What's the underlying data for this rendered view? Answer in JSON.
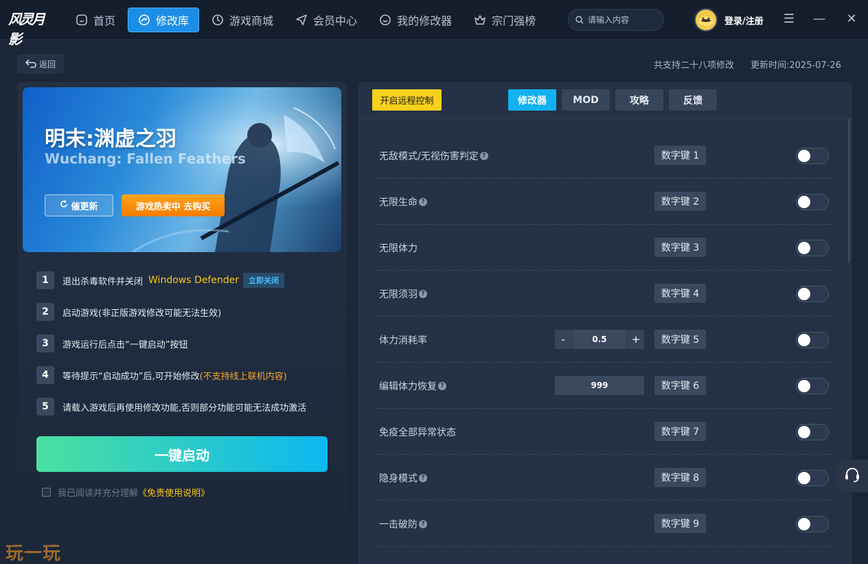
{
  "app": {
    "logo_text": "风灵月影"
  },
  "nav": {
    "items": [
      {
        "label": "首页",
        "icon": "home-icon"
      },
      {
        "label": "修改库",
        "icon": "library-icon",
        "active": true
      },
      {
        "label": "游戏商城",
        "icon": "store-icon"
      },
      {
        "label": "会员中心",
        "icon": "send-icon"
      },
      {
        "label": "我的修改器",
        "icon": "chat-icon"
      },
      {
        "label": "宗门强榜",
        "icon": "crown-icon"
      }
    ]
  },
  "search": {
    "placeholder": "请输入内容"
  },
  "user": {
    "login_label": "登录/注册"
  },
  "window": {
    "menu": "☰",
    "minimize": "—",
    "close": "✕"
  },
  "subbar": {
    "back_label": "返回",
    "support_text": "共支持二十八项修改",
    "updated_label": "更新时间:",
    "updated_date": "2025-07-26"
  },
  "game": {
    "title_cn": "明末:渊虚之羽",
    "title_en": "Wuchang: Fallen Feathers",
    "update_button": "催更新",
    "buy_button": "游戏热卖中 去购买"
  },
  "steps": [
    {
      "num": "1",
      "text": "退出杀毒软件并关闭",
      "highlight": "Windows Defender",
      "action": "立即关闭"
    },
    {
      "num": "2",
      "text": "启动游戏(非正版游戏修改可能无法生效)"
    },
    {
      "num": "3",
      "text": "游戏运行后点击“一键启动”按钮"
    },
    {
      "num": "4",
      "text": "等待提示“启动成功”后,可开始修改",
      "highlight": "(不支持线上联机内容)"
    },
    {
      "num": "5",
      "text": "请载入游戏后再使用修改功能,否则部分功能可能无法成功激活"
    }
  ],
  "launch_button": "一键启动",
  "agreement": {
    "text": "我已阅读并充分理解",
    "link": "《免责使用说明》",
    "checked": false
  },
  "watermark": "玩一玩",
  "right": {
    "remote_button": "开启远程控制",
    "tabs": [
      {
        "label": "修改器",
        "active": true
      },
      {
        "label": "MOD"
      },
      {
        "label": "攻略"
      },
      {
        "label": "反馈"
      }
    ],
    "cheats": [
      {
        "name": "无敌模式/无视伤害判定",
        "help": true,
        "hotkey": "数字键 1",
        "enabled": false
      },
      {
        "name": "无限生命",
        "help": true,
        "hotkey": "数字键 2",
        "enabled": false
      },
      {
        "name": "无限体力",
        "help": false,
        "hotkey": "数字键 3",
        "enabled": false
      },
      {
        "name": "无限须羽",
        "help": true,
        "hotkey": "数字键 4",
        "enabled": false
      },
      {
        "name": "体力消耗率",
        "help": false,
        "hotkey": "数字键 5",
        "enabled": false,
        "stepper": {
          "minus": "-",
          "value": "0.5",
          "plus": "+"
        }
      },
      {
        "name": "编辑体力恢复",
        "help": true,
        "hotkey": "数字键 6",
        "enabled": false,
        "input_value": "999"
      },
      {
        "name": "免疫全部异常状态",
        "help": false,
        "hotkey": "数字键 7",
        "enabled": false
      },
      {
        "name": "隐身模式",
        "help": true,
        "hotkey": "数字键 8",
        "enabled": false
      },
      {
        "name": "一击破防",
        "help": true,
        "hotkey": "数字键 9",
        "enabled": false
      }
    ]
  },
  "colors": {
    "accent": "#1d8ee6",
    "remote_yellow": "#f7d11c",
    "tab_active": "#13b1f2",
    "launch_start": "#4be0a0",
    "launch_end": "#0cb7f0",
    "buy_orange": "#f57c00"
  }
}
